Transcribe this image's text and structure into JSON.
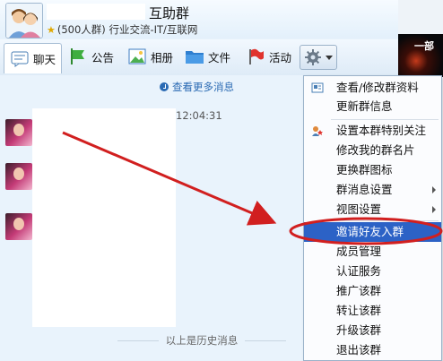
{
  "header": {
    "group_name": "互助群",
    "group_info": "(500人群) 行业交流-IT/互联网"
  },
  "toolbar": {
    "chat_label": "聊天",
    "notice_label": "公告",
    "album_label": "相册",
    "files_label": "文件",
    "activity_label": "活动"
  },
  "ad": {
    "text": "一部"
  },
  "chat": {
    "more_messages": "查看更多消息",
    "timestamp": "12:04:31",
    "history_divider": "以上是历史消息"
  },
  "menu": {
    "items": [
      {
        "label": "查看/修改群资料",
        "icon": "profile-card-icon"
      },
      {
        "label": "更新群信息"
      },
      {
        "label": "设置本群特别关注",
        "icon": "special-follow-icon"
      },
      {
        "label": "修改我的群名片"
      },
      {
        "label": "更换群图标"
      },
      {
        "label": "群消息设置",
        "submenu": true
      },
      {
        "label": "视图设置",
        "submenu": true
      },
      {
        "label": "邀请好友入群",
        "selected": true
      },
      {
        "label": "成员管理"
      },
      {
        "label": "认证服务"
      },
      {
        "label": "推广该群"
      },
      {
        "label": "转让该群"
      },
      {
        "label": "升级该群"
      },
      {
        "label": "退出该群"
      }
    ]
  },
  "colors": {
    "menu_highlight": "#2c62c6",
    "annotation_red": "#d11f1f",
    "link_blue": "#2a6ab3"
  }
}
